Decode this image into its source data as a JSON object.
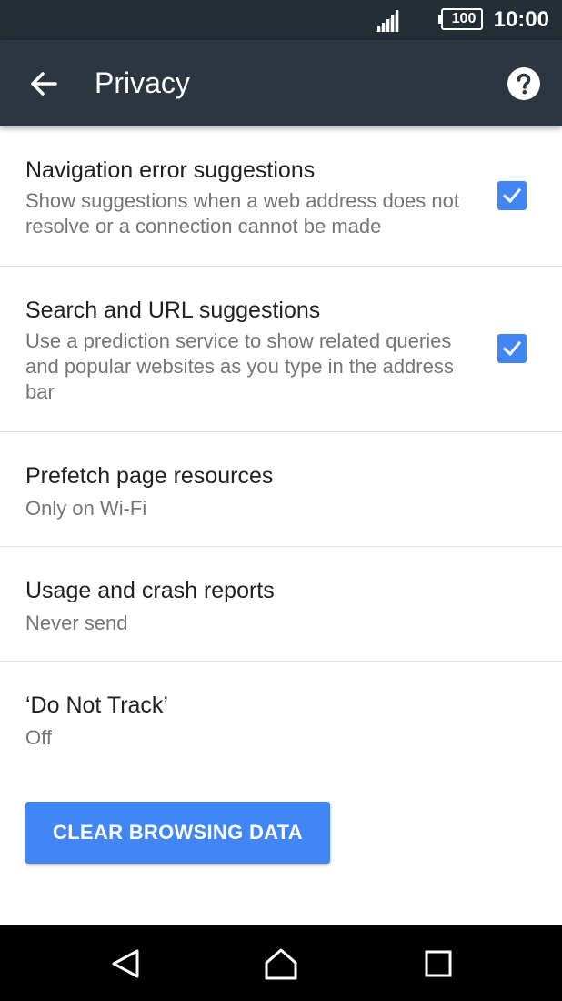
{
  "status_bar": {
    "battery": "100",
    "time": "10:00"
  },
  "app_bar": {
    "title": "Privacy",
    "back_icon": "arrow-left-icon",
    "help_icon": "help-circle-icon"
  },
  "settings": [
    {
      "title": "Navigation error suggestions",
      "summary": "Show suggestions when a web address does not resolve or a connection cannot be made",
      "checked": true
    },
    {
      "title": "Search and URL suggestions",
      "summary": "Use a prediction service to show related queries and popular websites as you type in the address bar",
      "checked": true
    },
    {
      "title": "Prefetch page resources",
      "summary": "Only on Wi-Fi"
    },
    {
      "title": "Usage and crash reports",
      "summary": "Never send"
    },
    {
      "title": "‘Do Not Track’",
      "summary": "Off"
    }
  ],
  "clear_button": {
    "label": "CLEAR BROWSING DATA"
  },
  "colors": {
    "status_bar": "#232d36",
    "app_bar": "#2b3640",
    "accent": "#4285f4",
    "title_text": "#212121",
    "summary_text": "#757575"
  }
}
